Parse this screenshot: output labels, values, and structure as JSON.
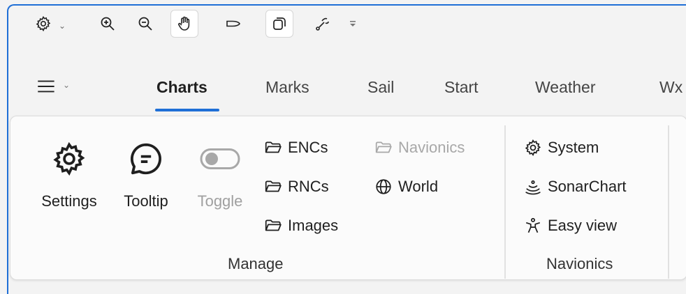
{
  "quick_access": {
    "items": [
      {
        "id": "settings",
        "icon": "gear-icon",
        "has_dropdown": true
      },
      {
        "id": "zoom-in",
        "icon": "zoom-in-icon"
      },
      {
        "id": "zoom-out",
        "icon": "zoom-out-icon"
      },
      {
        "id": "pan",
        "icon": "hand-icon",
        "active": true
      },
      {
        "id": "boat",
        "icon": "boat-icon"
      },
      {
        "id": "window",
        "icon": "window-stack-icon",
        "active": true
      },
      {
        "id": "route",
        "icon": "route-icon"
      },
      {
        "id": "more",
        "icon": "overflow-icon"
      }
    ]
  },
  "tabs": [
    {
      "label": "Charts",
      "selected": true
    },
    {
      "label": "Marks"
    },
    {
      "label": "Sail"
    },
    {
      "label": "Start"
    },
    {
      "label": "Weather"
    },
    {
      "label": "Wx"
    }
  ],
  "ribbon": {
    "manage": {
      "label": "Manage",
      "settings_label": "Settings",
      "tooltip_label": "Tooltip",
      "toggle_label": "Toggle",
      "encs_label": "ENCs",
      "rncs_label": "RNCs",
      "images_label": "Images",
      "navionics_label": "Navionics",
      "world_label": "World"
    },
    "navionics": {
      "label": "Navionics",
      "system_label": "System",
      "sonarchart_label": "SonarChart",
      "easyview_label": "Easy view"
    }
  },
  "colors": {
    "accent": "#1f6fd6",
    "disabled_text": "#a0a0a0",
    "ribbon_bg": "#fbfbfb"
  }
}
